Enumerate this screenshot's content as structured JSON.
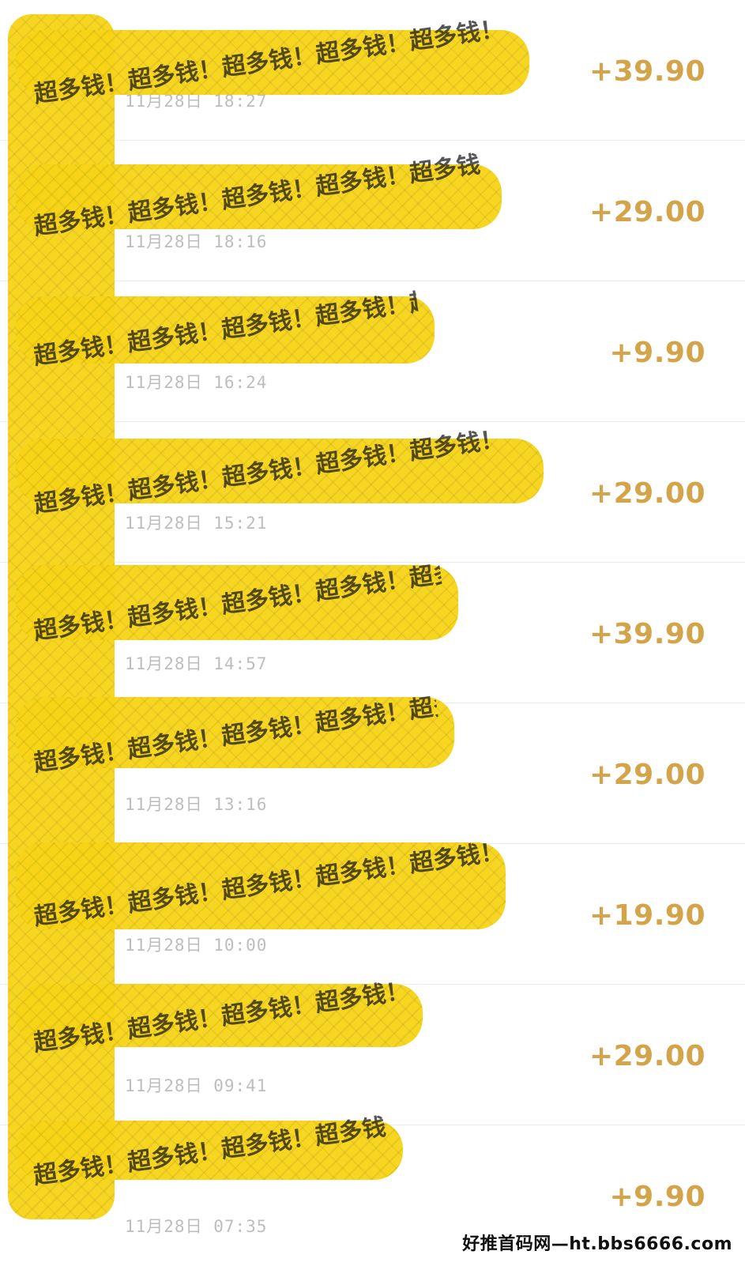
{
  "transactions": [
    {
      "time": "11月28日 18:27",
      "amount": "+39.90"
    },
    {
      "time": "11月28日 18:16",
      "amount": "+29.00"
    },
    {
      "time": "11月28日 16:24",
      "amount": "+9.90"
    },
    {
      "time": "11月28日 15:21",
      "amount": "+29.00"
    },
    {
      "time": "11月28日 14:57",
      "amount": "+39.90"
    },
    {
      "time": "11月28日 13:16",
      "amount": "+29.00"
    },
    {
      "time": "11月28日 10:00",
      "amount": "+19.90"
    },
    {
      "time": "11月28日 09:41",
      "amount": "+29.00"
    },
    {
      "time": "11月28日 07:35",
      "amount": "+9.90"
    }
  ],
  "redaction": {
    "scribble_text": "超多钱！超多钱！超多钱！超多钱！超多钱！",
    "color": "#f7d417"
  },
  "footer": {
    "watermark": "好推首码网—ht.bbs6666.com"
  },
  "colors": {
    "amount": "#d3a44a",
    "time": "#bdbdbd",
    "divider": "#ececec"
  }
}
